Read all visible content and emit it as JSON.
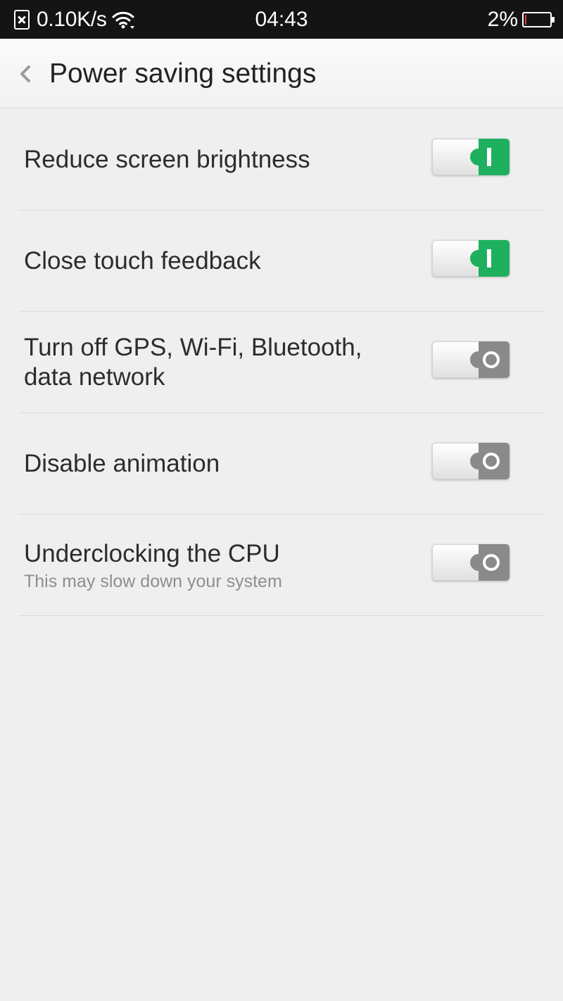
{
  "status_bar": {
    "net_speed": "0.10K/s",
    "time": "04:43",
    "battery": "2%",
    "icons": [
      "sim-error-icon",
      "wifi-icon",
      "battery-icon"
    ]
  },
  "header": {
    "title": "Power saving settings",
    "back_icon": "chevron-left-icon"
  },
  "settings": [
    {
      "label": "Reduce screen brightness",
      "subtitle": "",
      "enabled": true
    },
    {
      "label": "Close touch feedback",
      "subtitle": "",
      "enabled": true
    },
    {
      "label": "Turn off GPS, Wi-Fi, Bluetooth, data network",
      "subtitle": "",
      "enabled": false
    },
    {
      "label": "Disable animation",
      "subtitle": "",
      "enabled": false
    },
    {
      "label": "Underclocking the CPU",
      "subtitle": "This may slow down your system",
      "enabled": false
    }
  ],
  "colors": {
    "toggle_on": "#1fb05f",
    "toggle_off": "#8a8a8a",
    "background": "#efefef",
    "status_bar": "#141414"
  }
}
